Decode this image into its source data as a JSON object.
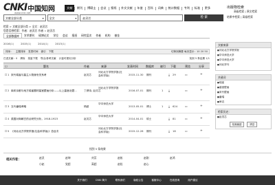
{
  "logo": {
    "mark": "CNKI",
    "cn": "中国知网",
    "url": "www.cnki.net"
  },
  "nav": {
    "items": [
      "文献",
      "期刊",
      "博硕士",
      "会议",
      "报纸",
      "外文文献",
      "年鉴",
      "百科",
      "词典",
      "统计数据",
      "专利",
      "标准",
      "更多"
    ],
    "active_index": 0
  },
  "org": {
    "name": "出版物检索",
    "link": "高级检索 | 原文检索"
  },
  "search": {
    "scope": "文献全部分类",
    "field": "全文",
    "query": "赵灵芯",
    "button": "检 索",
    "adv": "结果中检索 | 高级检索"
  },
  "crumbs": {
    "line1": "检索 > 文献全部分类 > 全文：赵灵芯",
    "line2": "您是否想检索：作者：赵灵芯  作者 = 赵灵芯"
  },
  "tabs": [
    "全部数据库",
    "学术期刊",
    "硕博论文",
    "学位",
    "会议",
    "报纸",
    "研究层次",
    "作者",
    "机构",
    "基金"
  ],
  "tabs_active": 0,
  "years": [
    {
      "y": "2016",
      "c": "(1)"
    },
    {
      "y": "2015",
      "c": "(1)"
    },
    {
      "y": "2014",
      "c": "(1)"
    },
    {
      "y": "2013",
      "c": "(1)"
    }
  ],
  "sortbar": {
    "items": [
      "排序：",
      "主题排序",
      "发表时间",
      "被引",
      "下载"
    ],
    "right": "切换到摘要  每页显示：10  20  50"
  },
  "toolbar": {
    "items": [
      "已选文献：0",
      "清除",
      "批量下载",
      "导出/参考文献",
      "计量可视化分析"
    ],
    "found": "找到 5 条结果  1/1"
  },
  "thead": {
    "num": "",
    "title": "题名",
    "author": "作者",
    "source": "来源",
    "date": "发表时间",
    "db": "数据库",
    "cite": "被引",
    "dl": "下载",
    "read": "预览",
    "share": "分享"
  },
  "rows": [
    {
      "num": "1",
      "title": "宋代瑞雀与墓主人物身份关系考",
      "author": "赵灵芯",
      "src": "河北北方学院学报(社会科学版)",
      "date": "2015-11-30",
      "db": "期刊",
      "cite": "",
      "dl": "29"
    },
    {
      "num": "2",
      "title": "南宋京都与地方瑞雀题材墓室壁画分析——以上墓室北壁...",
      "author": "丁健伟; 赵灵芯",
      "src": "河北北方学院学报",
      "date": "2016-07-01",
      "db": "期刊",
      "cite": "1",
      "dl": ""
    },
    {
      "num": "3",
      "title": "五代番瑞考略",
      "author": "杨超",
      "src": "华中师范大学",
      "date": "2013-05-01",
      "db": "博士",
      "cite": "1",
      "dl": "624"
    },
    {
      "num": "4",
      "title": "英国对商朝古的点研究分析，1918-1923",
      "author": "赵灵芯",
      "src": "华中师范大学",
      "date": "2014-04-01",
      "db": "硕士",
      "cite": "",
      "dl": "81"
    },
    {
      "num": "5",
      "title": "《河北北方学院学报(社会科学版)》总目次",
      "author": "",
      "src": "河北北方学院学报(社会科学版)",
      "date": "2015-12-28",
      "db": "期刊",
      "cite": "",
      "dl": "18"
    }
  ],
  "found_bottom": "找到 5 条结果",
  "side": {
    "p1_title": "文献来源",
    "p1_items": [
      "河北北方学院学报",
      "华中师范大学",
      "华中师范大学",
      "河北学刊"
    ],
    "p2_title": "关键词",
    "p2_items": [
      "瑞雀",
      "墓室壁画",
      "宋代壁画",
      "番瑞",
      "审边"
    ],
    "p3_title": "检索历史：",
    "p3_items": [
      "赵灵芯"
    ],
    "p3_btns": [
      "检索痕迹",
      "清空"
    ]
  },
  "related": {
    "label": "相关作者：",
    "row1": [
      "赵灵",
      "赵坤",
      "刘芳",
      "赵彬",
      "赵刚",
      "赵鸿"
    ],
    "row2": [
      "小赵",
      "党超",
      "高超",
      "赵松",
      "赵心"
    ]
  },
  "footer": [
    "关于我们",
    "CNKI 简介",
    "联系我们",
    "版权公告",
    "客服中心",
    "在线咨询",
    "用户建议"
  ]
}
